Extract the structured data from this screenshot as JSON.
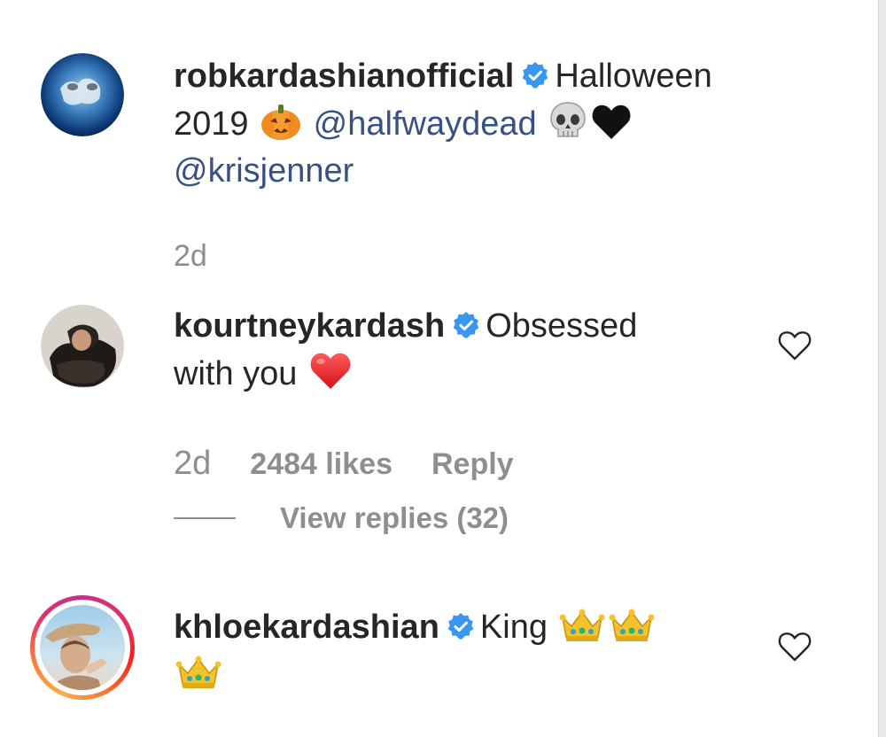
{
  "caption": {
    "username": "robkardashianofficial",
    "text_part1": "Halloween",
    "text_part2": "2019",
    "mention1": "@halfwaydead",
    "mention2": "@krisjenner",
    "time": "2d",
    "emojis": [
      "jack-o-lantern",
      "skull",
      "black-heart"
    ]
  },
  "comments": [
    {
      "username": "kourtneykardash",
      "text_part1": "Obsessed",
      "text_part2": "with you",
      "emojis": [
        "red-heart"
      ],
      "time": "2d",
      "likes": "2484 likes",
      "reply_label": "Reply",
      "view_replies": "View replies (32)"
    },
    {
      "username": "khloekardashian",
      "text_part1": "King",
      "emojis": [
        "crown",
        "crown",
        "crown"
      ]
    }
  ],
  "colors": {
    "verified_badge": "#3897f0",
    "mention": "#385185",
    "meta_text": "#8e8e8e",
    "story_ring_start": "#c13584",
    "story_ring_end": "#fcaf45"
  },
  "icons": [
    "verified-badge-icon",
    "heart-outline-icon",
    "pumpkin-emoji",
    "skull-emoji",
    "black-heart-emoji",
    "red-heart-emoji",
    "crown-emoji"
  ]
}
